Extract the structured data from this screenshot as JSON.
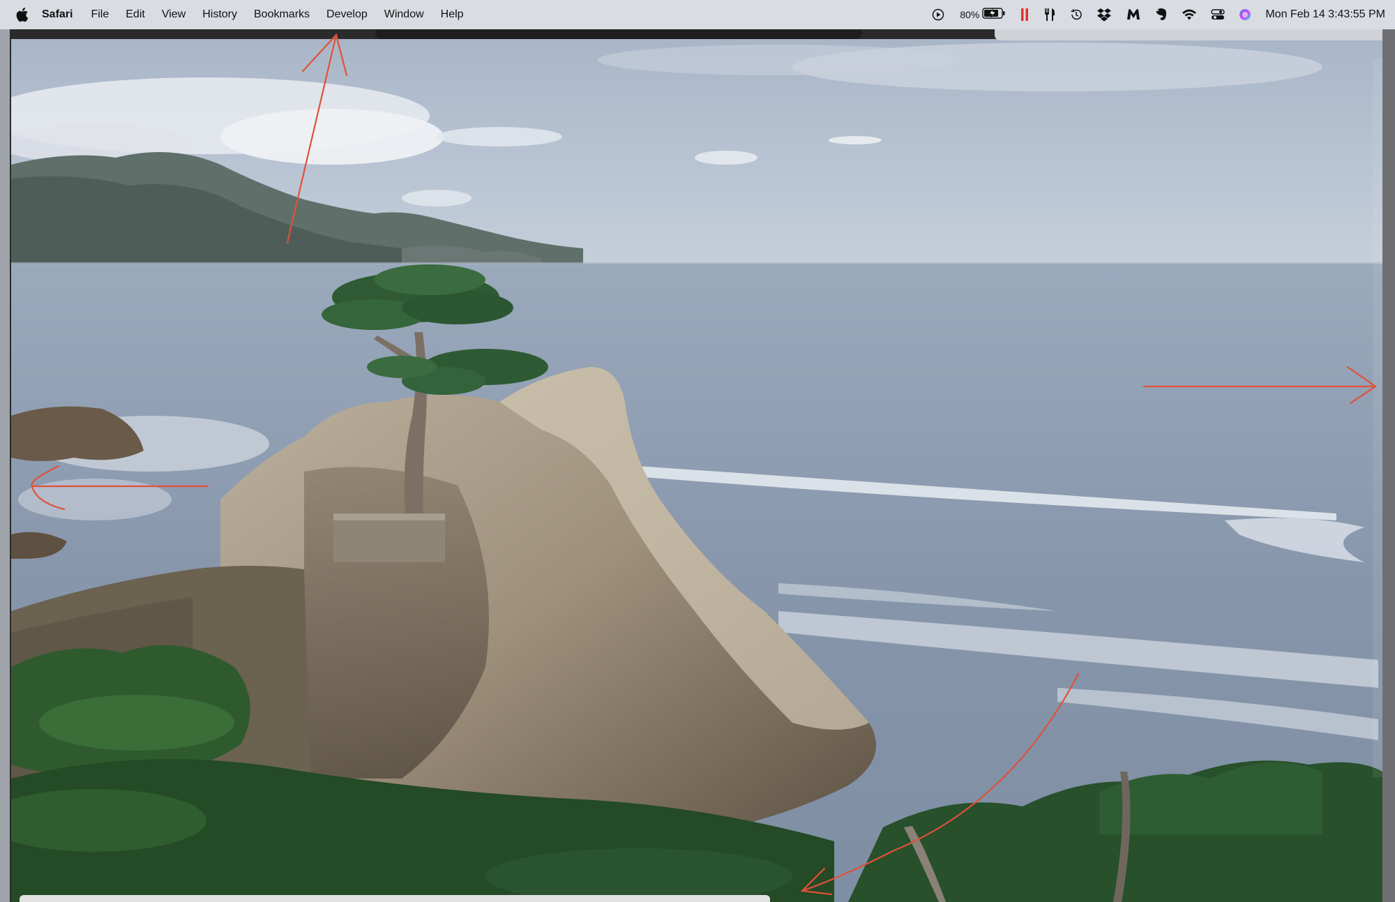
{
  "menubar": {
    "apple_icon": "apple-logo-icon",
    "app_name": "Safari",
    "menus": [
      "File",
      "Edit",
      "View",
      "History",
      "Bookmarks",
      "Develop",
      "Window",
      "Help"
    ],
    "status_icons": [
      "play-circle-icon",
      "pause-bars-icon",
      "fork-knife-icon",
      "time-machine-icon",
      "dropbox-icon",
      "malwarebytes-icon",
      "evernote-icon",
      "wifi-icon",
      "control-center-icon",
      "siri-icon"
    ],
    "battery_percent": "80%",
    "clock": "Mon Feb 14  3:43:55 PM"
  },
  "content": {
    "image_subject": "coastal cypress tree on rocky outcrop above ocean",
    "annotation_color": "#e0513a"
  }
}
